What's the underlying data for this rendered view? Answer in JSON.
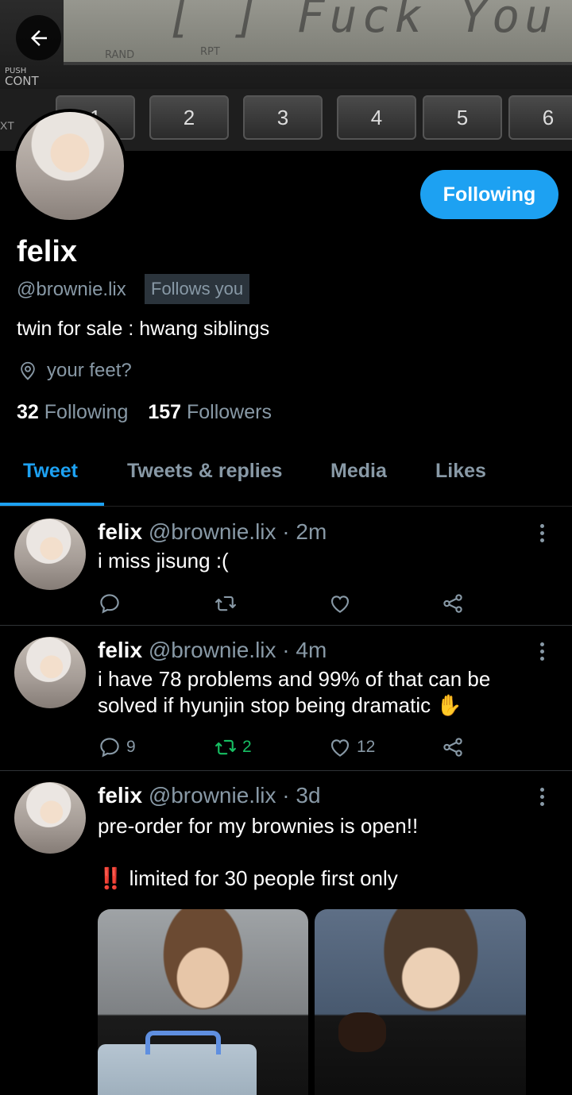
{
  "banner": {
    "lcd_text": "[ ] Fuck You",
    "lcd_rand": "RAND",
    "lcd_rpt": "RPT",
    "push": "PUSH",
    "cont": "CONT",
    "ext": "XT",
    "preset_buttons": [
      "1",
      "2",
      "3",
      "4",
      "5",
      "6"
    ]
  },
  "profile": {
    "name": "felix",
    "handle": "@brownie.lix",
    "follows_you": "Follows you",
    "follow_button": "Following",
    "bio": "twin for sale : hwang siblings",
    "location": "your feet?",
    "following_count": "32",
    "following_label": "Following",
    "followers_count": "157",
    "followers_label": "Followers"
  },
  "tabs": [
    "Tweet",
    "Tweets & replies",
    "Media",
    "Likes"
  ],
  "tweets": [
    {
      "name": "felix",
      "handle": "@brownie.lix",
      "time": "· 2m",
      "text": "i miss jisung :(",
      "replies": "",
      "retweets": "",
      "likes": ""
    },
    {
      "name": "felix",
      "handle": "@brownie.lix",
      "time": "· 4m",
      "text": "i have 78 problems and 99% of that can be solved if hyunjin stop being dramatic ✋",
      "replies": "9",
      "retweets": "2",
      "likes": "12"
    },
    {
      "name": "felix",
      "handle": "@brownie.lix",
      "time": "· 3d",
      "text": "pre-order for my brownies is open!!",
      "text2": "‼️ limited for 30 people first only"
    }
  ],
  "colors": {
    "accent": "#1da1f2",
    "muted": "#8899a6",
    "retweet": "#17bf63",
    "background": "#000000"
  }
}
